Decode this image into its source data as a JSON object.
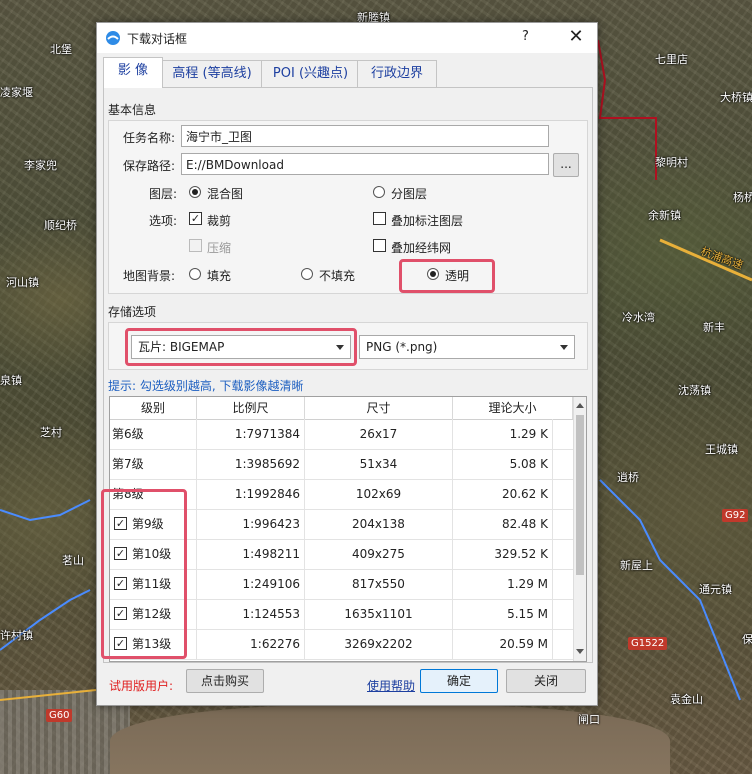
{
  "map": {
    "labels": [
      "新塍镇",
      "北堡",
      "七里店",
      "凌家堰",
      "大桥镇",
      "李家兜",
      "黎明村",
      "杨桥",
      "顺纪桥",
      "余新镇",
      "河山镇",
      "新丰",
      "冷水湾",
      "泉镇",
      "芝村",
      "沈荡镇",
      "王城镇",
      "逍桥",
      "茗山",
      "新屋上",
      "许村镇",
      "通元镇",
      "保",
      "袁金山",
      "闸口"
    ],
    "road_badges": [
      "G92",
      "G1522",
      "G60"
    ],
    "highway_label": "杭浦高速"
  },
  "dialog": {
    "title": "下载对话框",
    "help_glyph": "?",
    "close_glyph": "✕",
    "tabs": [
      "影 像",
      "高程 (等高线)",
      "POI (兴趣点)",
      "行政边界"
    ],
    "basic_info": {
      "section_title": "基本信息",
      "task_name_label": "任务名称:",
      "task_name_value": "海宁市_卫图",
      "save_path_label": "保存路径:",
      "save_path_value": "E://BMDownload",
      "browse_label": "...",
      "layer_label": "图层:",
      "layer_options": [
        "混合图",
        "分图层"
      ],
      "layer_selected": "混合图",
      "options_label": "选项:",
      "opt_crop": "裁剪",
      "opt_compress": "压缩",
      "opt_overlay_labels": "叠加标注图层",
      "opt_overlay_grid": "叠加经纬网",
      "bg_label": "地图背景:",
      "bg_options": [
        "填充",
        "不填充",
        "透明"
      ],
      "bg_selected": "透明"
    },
    "storage": {
      "section_title": "存储选项",
      "tile_format": "瓦片: BIGEMAP",
      "image_format": "PNG (*.png)"
    },
    "hint": "提示: 勾选级别越高, 下载影像越清晰",
    "table": {
      "headers": [
        "级别",
        "比例尺",
        "尺寸",
        "理论大小"
      ],
      "rows": [
        {
          "level": "第6级",
          "scale": "1:7971384",
          "size": "26x17",
          "est": "1.29 K",
          "checkbox": false,
          "checked": false
        },
        {
          "level": "第7级",
          "scale": "1:3985692",
          "size": "51x34",
          "est": "5.08 K",
          "checkbox": false,
          "checked": false
        },
        {
          "level": "第8级",
          "scale": "1:1992846",
          "size": "102x69",
          "est": "20.62 K",
          "checkbox": false,
          "checked": false
        },
        {
          "level": "第9级",
          "scale": "1:996423",
          "size": "204x138",
          "est": "82.48 K",
          "checkbox": true,
          "checked": true
        },
        {
          "level": "第10级",
          "scale": "1:498211",
          "size": "409x275",
          "est": "329.52 K",
          "checkbox": true,
          "checked": true
        },
        {
          "level": "第11级",
          "scale": "1:249106",
          "size": "817x550",
          "est": "1.29 M",
          "checkbox": true,
          "checked": true
        },
        {
          "level": "第12级",
          "scale": "1:124553",
          "size": "1635x1101",
          "est": "5.15 M",
          "checkbox": true,
          "checked": true
        },
        {
          "level": "第13级",
          "scale": "1:62276",
          "size": "3269x2202",
          "est": "20.59 M",
          "checkbox": true,
          "checked": true
        }
      ]
    },
    "footer": {
      "trial_label": "试用版用户:",
      "buy_label": "点击购买",
      "help_link": "使用帮助",
      "ok_label": "确定",
      "close_label": "关闭"
    }
  },
  "colors": {
    "highlight": "#e0506a",
    "link": "#1d3fa0",
    "hint": "#1d5fc1",
    "trial": "#e02020"
  }
}
